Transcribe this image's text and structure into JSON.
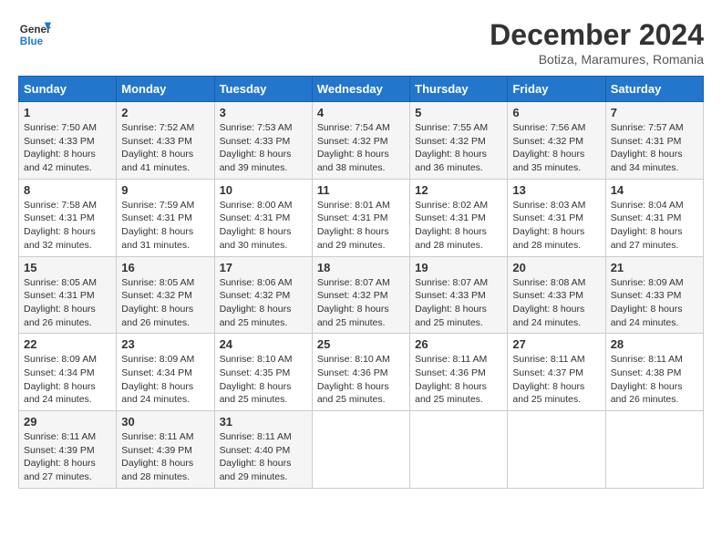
{
  "header": {
    "logo_general": "General",
    "logo_blue": "Blue",
    "title": "December 2024",
    "location": "Botiza, Maramures, Romania"
  },
  "days_of_week": [
    "Sunday",
    "Monday",
    "Tuesday",
    "Wednesday",
    "Thursday",
    "Friday",
    "Saturday"
  ],
  "weeks": [
    [
      {
        "day": "1",
        "info": "Sunrise: 7:50 AM\nSunset: 4:33 PM\nDaylight: 8 hours and 42 minutes."
      },
      {
        "day": "2",
        "info": "Sunrise: 7:52 AM\nSunset: 4:33 PM\nDaylight: 8 hours and 41 minutes."
      },
      {
        "day": "3",
        "info": "Sunrise: 7:53 AM\nSunset: 4:33 PM\nDaylight: 8 hours and 39 minutes."
      },
      {
        "day": "4",
        "info": "Sunrise: 7:54 AM\nSunset: 4:32 PM\nDaylight: 8 hours and 38 minutes."
      },
      {
        "day": "5",
        "info": "Sunrise: 7:55 AM\nSunset: 4:32 PM\nDaylight: 8 hours and 36 minutes."
      },
      {
        "day": "6",
        "info": "Sunrise: 7:56 AM\nSunset: 4:32 PM\nDaylight: 8 hours and 35 minutes."
      },
      {
        "day": "7",
        "info": "Sunrise: 7:57 AM\nSunset: 4:31 PM\nDaylight: 8 hours and 34 minutes."
      }
    ],
    [
      {
        "day": "8",
        "info": "Sunrise: 7:58 AM\nSunset: 4:31 PM\nDaylight: 8 hours and 32 minutes."
      },
      {
        "day": "9",
        "info": "Sunrise: 7:59 AM\nSunset: 4:31 PM\nDaylight: 8 hours and 31 minutes."
      },
      {
        "day": "10",
        "info": "Sunrise: 8:00 AM\nSunset: 4:31 PM\nDaylight: 8 hours and 30 minutes."
      },
      {
        "day": "11",
        "info": "Sunrise: 8:01 AM\nSunset: 4:31 PM\nDaylight: 8 hours and 29 minutes."
      },
      {
        "day": "12",
        "info": "Sunrise: 8:02 AM\nSunset: 4:31 PM\nDaylight: 8 hours and 28 minutes."
      },
      {
        "day": "13",
        "info": "Sunrise: 8:03 AM\nSunset: 4:31 PM\nDaylight: 8 hours and 28 minutes."
      },
      {
        "day": "14",
        "info": "Sunrise: 8:04 AM\nSunset: 4:31 PM\nDaylight: 8 hours and 27 minutes."
      }
    ],
    [
      {
        "day": "15",
        "info": "Sunrise: 8:05 AM\nSunset: 4:31 PM\nDaylight: 8 hours and 26 minutes."
      },
      {
        "day": "16",
        "info": "Sunrise: 8:05 AM\nSunset: 4:32 PM\nDaylight: 8 hours and 26 minutes."
      },
      {
        "day": "17",
        "info": "Sunrise: 8:06 AM\nSunset: 4:32 PM\nDaylight: 8 hours and 25 minutes."
      },
      {
        "day": "18",
        "info": "Sunrise: 8:07 AM\nSunset: 4:32 PM\nDaylight: 8 hours and 25 minutes."
      },
      {
        "day": "19",
        "info": "Sunrise: 8:07 AM\nSunset: 4:33 PM\nDaylight: 8 hours and 25 minutes."
      },
      {
        "day": "20",
        "info": "Sunrise: 8:08 AM\nSunset: 4:33 PM\nDaylight: 8 hours and 24 minutes."
      },
      {
        "day": "21",
        "info": "Sunrise: 8:09 AM\nSunset: 4:33 PM\nDaylight: 8 hours and 24 minutes."
      }
    ],
    [
      {
        "day": "22",
        "info": "Sunrise: 8:09 AM\nSunset: 4:34 PM\nDaylight: 8 hours and 24 minutes."
      },
      {
        "day": "23",
        "info": "Sunrise: 8:09 AM\nSunset: 4:34 PM\nDaylight: 8 hours and 24 minutes."
      },
      {
        "day": "24",
        "info": "Sunrise: 8:10 AM\nSunset: 4:35 PM\nDaylight: 8 hours and 25 minutes."
      },
      {
        "day": "25",
        "info": "Sunrise: 8:10 AM\nSunset: 4:36 PM\nDaylight: 8 hours and 25 minutes."
      },
      {
        "day": "26",
        "info": "Sunrise: 8:11 AM\nSunset: 4:36 PM\nDaylight: 8 hours and 25 minutes."
      },
      {
        "day": "27",
        "info": "Sunrise: 8:11 AM\nSunset: 4:37 PM\nDaylight: 8 hours and 25 minutes."
      },
      {
        "day": "28",
        "info": "Sunrise: 8:11 AM\nSunset: 4:38 PM\nDaylight: 8 hours and 26 minutes."
      }
    ],
    [
      {
        "day": "29",
        "info": "Sunrise: 8:11 AM\nSunset: 4:39 PM\nDaylight: 8 hours and 27 minutes."
      },
      {
        "day": "30",
        "info": "Sunrise: 8:11 AM\nSunset: 4:39 PM\nDaylight: 8 hours and 28 minutes."
      },
      {
        "day": "31",
        "info": "Sunrise: 8:11 AM\nSunset: 4:40 PM\nDaylight: 8 hours and 29 minutes."
      },
      null,
      null,
      null,
      null
    ]
  ]
}
